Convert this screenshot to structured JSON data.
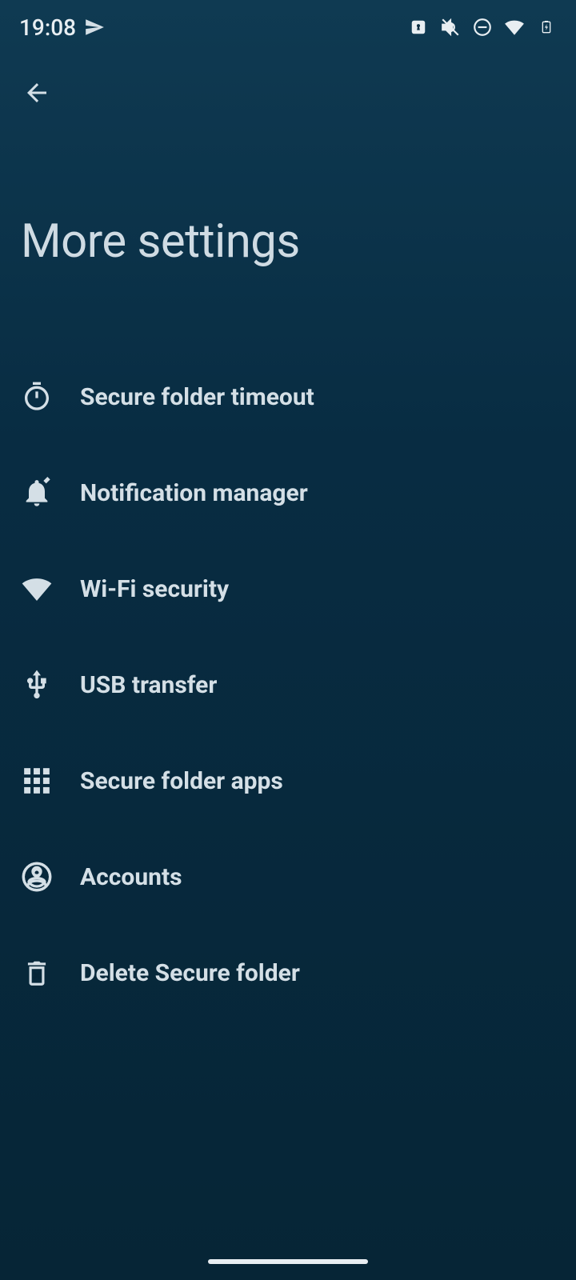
{
  "status": {
    "time": "19:08"
  },
  "header": {
    "title": "More settings"
  },
  "settings": {
    "items": [
      {
        "label": "Secure folder timeout",
        "icon": "timer-icon"
      },
      {
        "label": "Notification manager",
        "icon": "notification-edit-icon"
      },
      {
        "label": "Wi-Fi security",
        "icon": "wifi-icon"
      },
      {
        "label": "USB transfer",
        "icon": "usb-icon"
      },
      {
        "label": "Secure folder apps",
        "icon": "apps-grid-icon"
      },
      {
        "label": "Accounts",
        "icon": "account-circle-icon"
      },
      {
        "label": "Delete Secure folder",
        "icon": "delete-x-icon"
      }
    ]
  }
}
